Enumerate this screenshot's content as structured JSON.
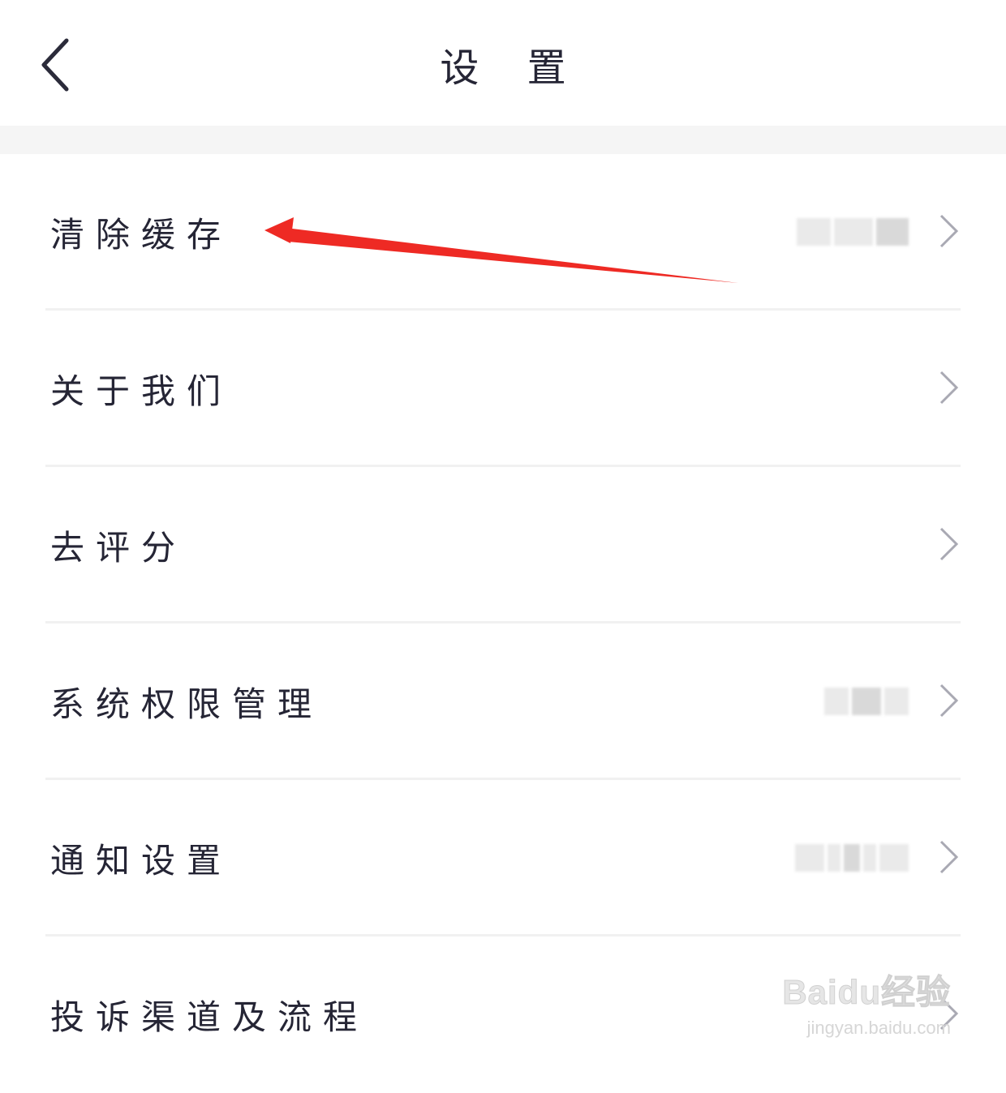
{
  "header": {
    "title": "设 置",
    "back_icon": "chevron-left-icon"
  },
  "settings": {
    "items": [
      {
        "label": "清除缓存",
        "value_blurred": true
      },
      {
        "label": "关于我们",
        "value_blurred": false
      },
      {
        "label": "去评分",
        "value_blurred": false
      },
      {
        "label": "系统权限管理",
        "value_blurred": true
      },
      {
        "label": "通知设置",
        "value_blurred": true
      },
      {
        "label": "投诉渠道及流程",
        "value_blurred": false
      }
    ],
    "row_icon": "chevron-right-icon"
  },
  "annotation": {
    "color": "#ee2a24",
    "points_to": "清除缓存"
  },
  "watermark": {
    "logo": "Baidu经验",
    "url": "jingyan.baidu.com"
  },
  "colors": {
    "text": "#252535",
    "chevron": "#a9a9b3",
    "divider": "#f1f1f1",
    "gap": "#f5f5f5"
  }
}
